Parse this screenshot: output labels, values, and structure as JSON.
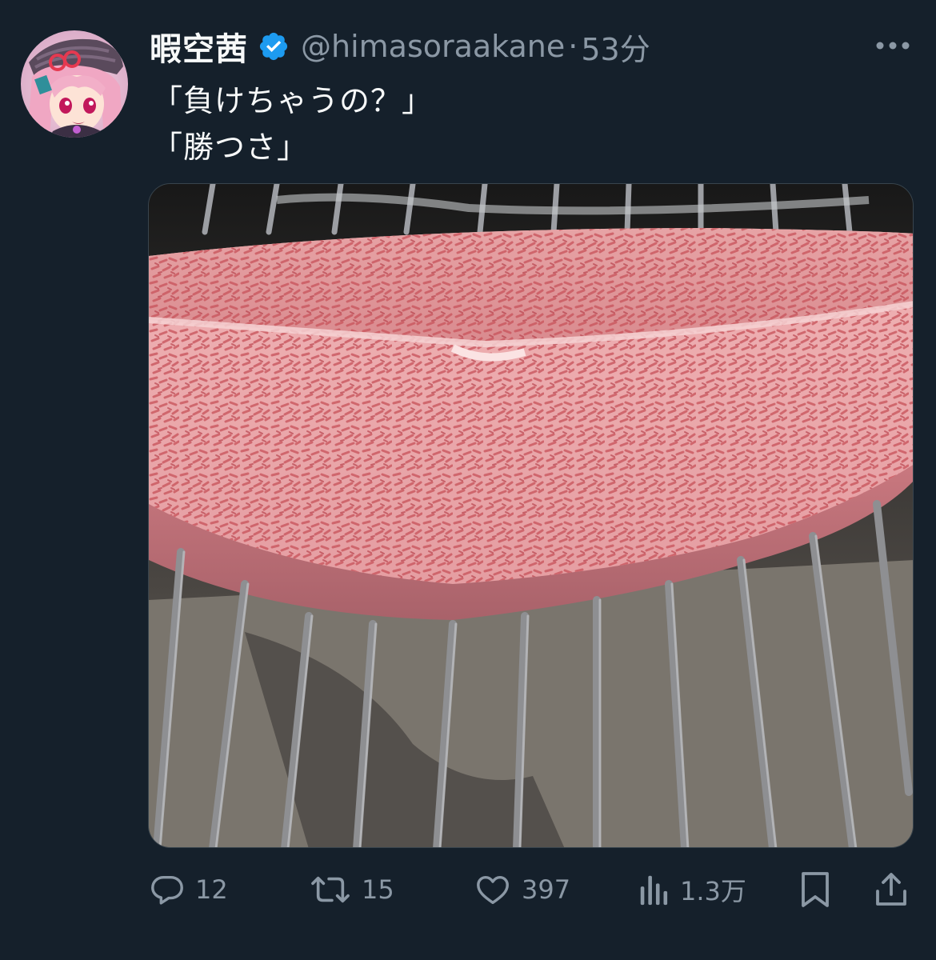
{
  "tweet": {
    "display_name": "暇空茜",
    "handle": "@himasoraakane",
    "separator": "·",
    "time": "53分",
    "text_lines": [
      "「負けちゃうの？」",
      "「勝つさ」"
    ],
    "media_alt": "霜降り肉の写真"
  },
  "actions": {
    "reply_count": "12",
    "retweet_count": "15",
    "like_count": "397",
    "views_count": "1.3万"
  },
  "icons": {
    "more": "more-icon",
    "verified": "verified-badge-icon",
    "reply": "reply-icon",
    "retweet": "retweet-icon",
    "like": "heart-icon",
    "views": "views-icon",
    "bookmark": "bookmark-icon",
    "share": "share-icon"
  },
  "colors": {
    "background": "#15202b",
    "text_primary": "#f7f9f9",
    "text_secondary": "#8b98a5",
    "verified": "#1d9bf0"
  }
}
